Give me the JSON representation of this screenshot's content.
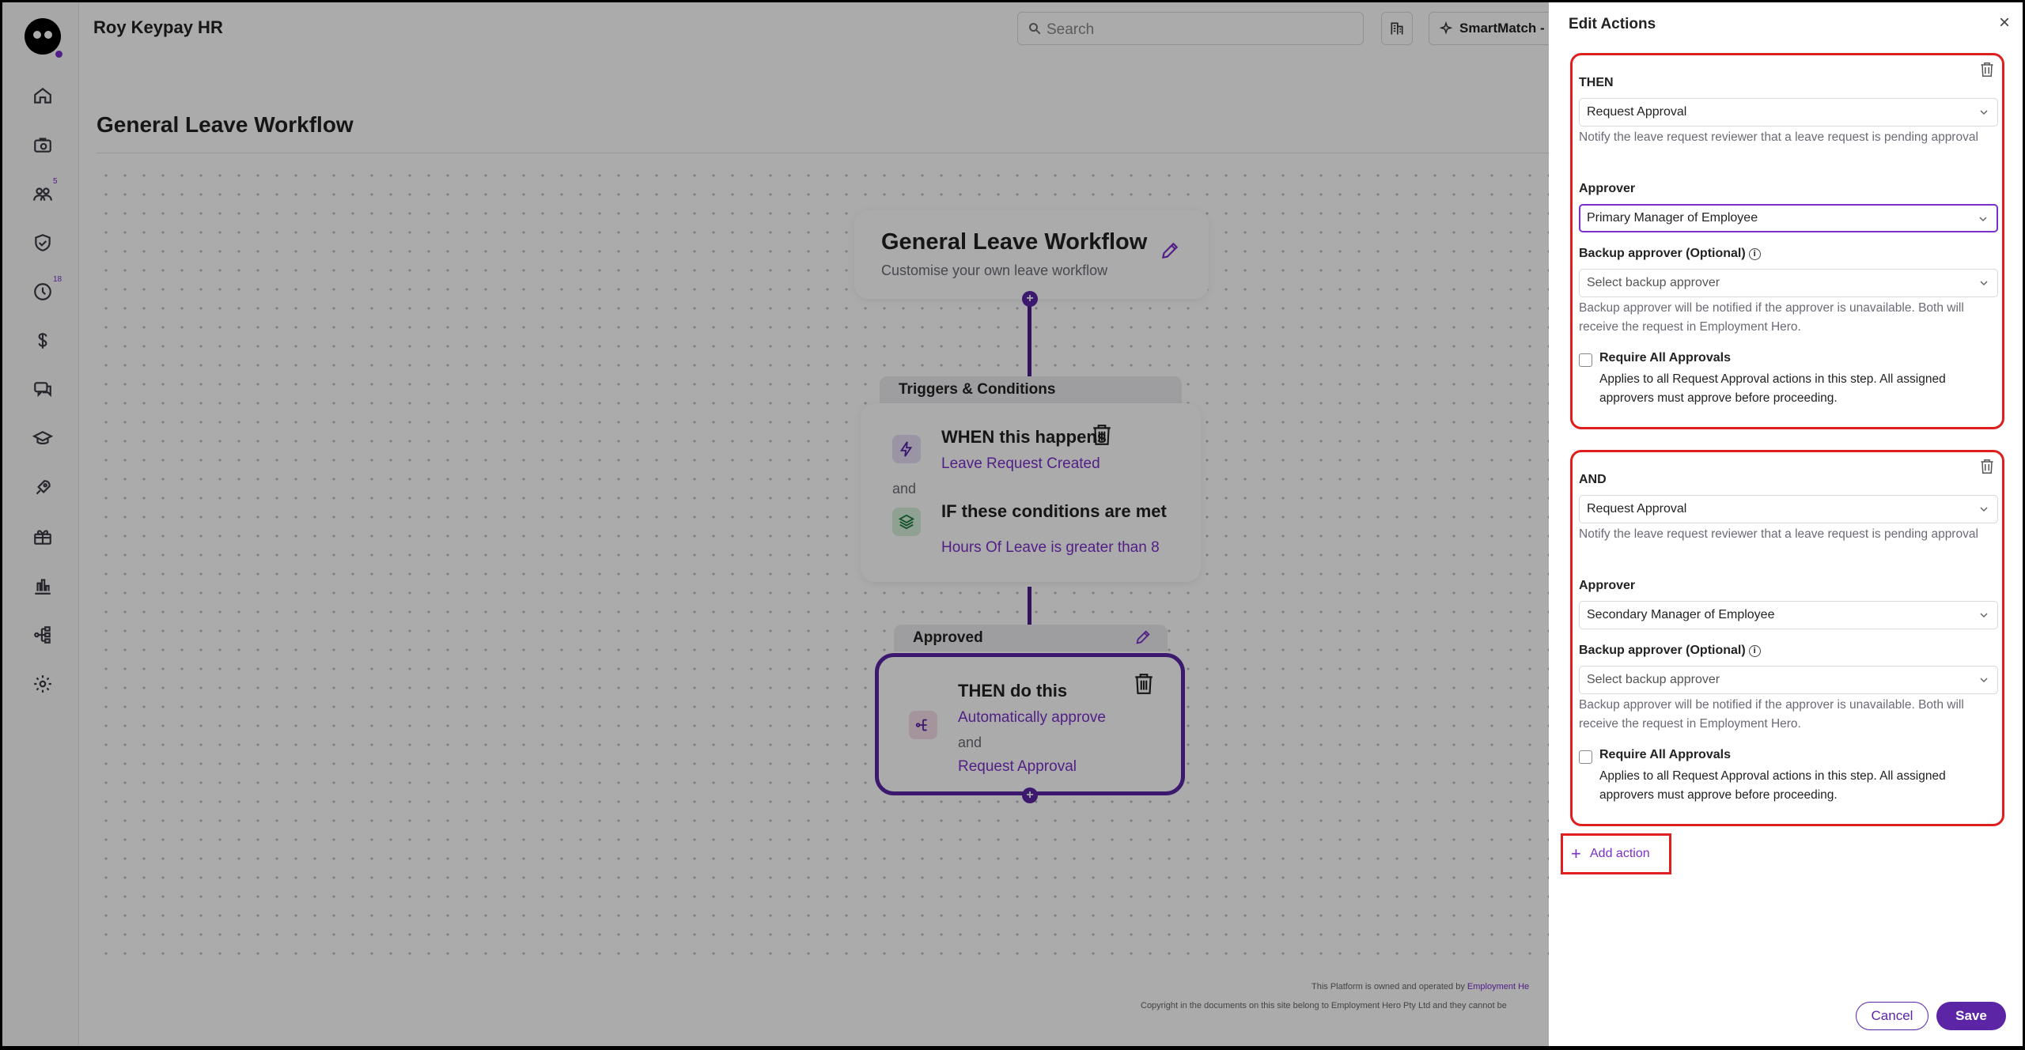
{
  "app": {
    "org_name": "Roy Keypay HR",
    "search_placeholder": "Search",
    "smartmatch_label": "SmartMatch -",
    "nav_badges": {
      "people": "5",
      "time": "18"
    }
  },
  "page": {
    "title": "General Leave Workflow"
  },
  "workflow": {
    "card_title": "General Leave Workflow",
    "card_subtitle": "Customise your own leave workflow",
    "triggers_header": "Triggers & Conditions",
    "when_title": "WHEN this happens",
    "when_value": "Leave Request Created",
    "and_text": "and",
    "if_title": "IF these conditions are met",
    "if_value": "Hours Of Leave is greater than 8",
    "approved_header": "Approved",
    "then_title": "THEN do this",
    "then_value1": "Automatically approve",
    "then_and": "and",
    "then_value2": "Request Approval"
  },
  "footer": {
    "line1_prefix": "This Platform is owned and operated by ",
    "line1_link": "Employment He",
    "line2": "Copyright in the documents on this site belong to Employment Hero Pty Ltd and they cannot be"
  },
  "drawer": {
    "title": "Edit Actions",
    "close_glyph": "×",
    "actions": [
      {
        "label": "THEN",
        "action_value": "Request Approval",
        "action_help": "Notify the leave request reviewer that a leave request is pending approval",
        "approver_label": "Approver",
        "approver_value": "Primary Manager of Employee",
        "backup_label": "Backup approver (Optional)",
        "backup_placeholder": "Select backup approver",
        "backup_help": "Backup approver will be notified if the approver is unavailable. Both will receive the request in Employment Hero.",
        "require_title": "Require All Approvals",
        "require_desc": "Applies to all Request Approval actions in this step. All assigned approvers must approve before proceeding."
      },
      {
        "label": "AND",
        "action_value": "Request Approval",
        "action_help": "Notify the leave request reviewer that a leave request is pending approval",
        "approver_label": "Approver",
        "approver_value": "Secondary Manager of Employee",
        "backup_label": "Backup approver (Optional)",
        "backup_placeholder": "Select backup approver",
        "backup_help": "Backup approver will be notified if the approver is unavailable. Both will receive the request in Employment Hero.",
        "require_title": "Require All Approvals",
        "require_desc": "Applies to all Request Approval actions in this step. All assigned approvers must approve before proceeding."
      }
    ],
    "add_action_label": "Add action",
    "cancel_label": "Cancel",
    "save_label": "Save"
  },
  "colors": {
    "brand": "#5b25a6",
    "accent_text": "#7b2fc9",
    "highlight": "#e01e1e"
  }
}
